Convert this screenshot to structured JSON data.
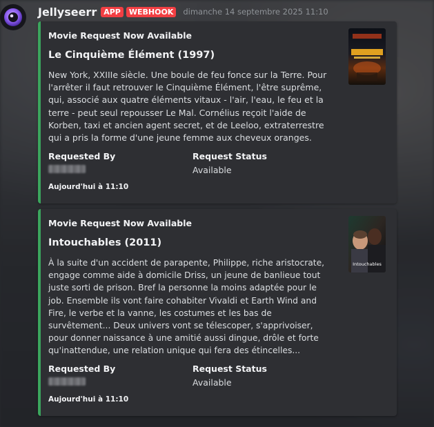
{
  "message": {
    "author": "Jellyseerr",
    "badges": [
      "APP",
      "WEBHOOK"
    ],
    "timestamp": "dimanche 14 septembre 2025 11:10"
  },
  "colors": {
    "accent_bar": "#3ba55d",
    "badge": "#f23f43",
    "embed_bg": "#2e2f33"
  },
  "embeds": [
    {
      "author": "Movie Request Now Available",
      "title": "Le Cinquième Élément (1997)",
      "description": "New York, XXIIIe siècle. Une boule de feu fonce sur la Terre. Pour l'arrêter il faut retrouver le Cinquième Élément, l'être suprême, qui, associé aux quatre éléments vitaux - l'air, l'eau, le feu et la terre - peut seul repousser Le Mal. Cornélius reçoit l'aide de Korben, taxi et ancien agent secret, et de Leeloo, extraterrestre qui a pris la forme d'une jeune femme aux cheveux oranges.",
      "fields": [
        {
          "name": "Requested By",
          "value": ""
        },
        {
          "name": "Request Status",
          "value": "Available"
        }
      ],
      "footer": "Aujourd'hui à 11:10",
      "thumbnail_icon": "movie-poster"
    },
    {
      "author": "Movie Request Now Available",
      "title": "Intouchables (2011)",
      "description": "À la suite d'un accident de parapente, Philippe, riche aristocrate, engage comme aide à domicile Driss, un jeune de banlieue tout juste sorti de prison. Bref la personne la moins adaptée pour le job. Ensemble ils vont faire cohabiter Vivaldi et Earth Wind and Fire, le verbe et la vanne, les costumes et les bas de survêtement... Deux univers vont se télescoper, s'apprivoiser, pour donner naissance à une amitié aussi dingue, drôle et forte qu'inattendue, une relation unique qui fera des étincelles...",
      "fields": [
        {
          "name": "Requested By",
          "value": ""
        },
        {
          "name": "Request Status",
          "value": "Available"
        }
      ],
      "footer": "Aujourd'hui à 11:10",
      "thumbnail_icon": "movie-poster",
      "thumbnail_caption": "Intouchables"
    }
  ]
}
